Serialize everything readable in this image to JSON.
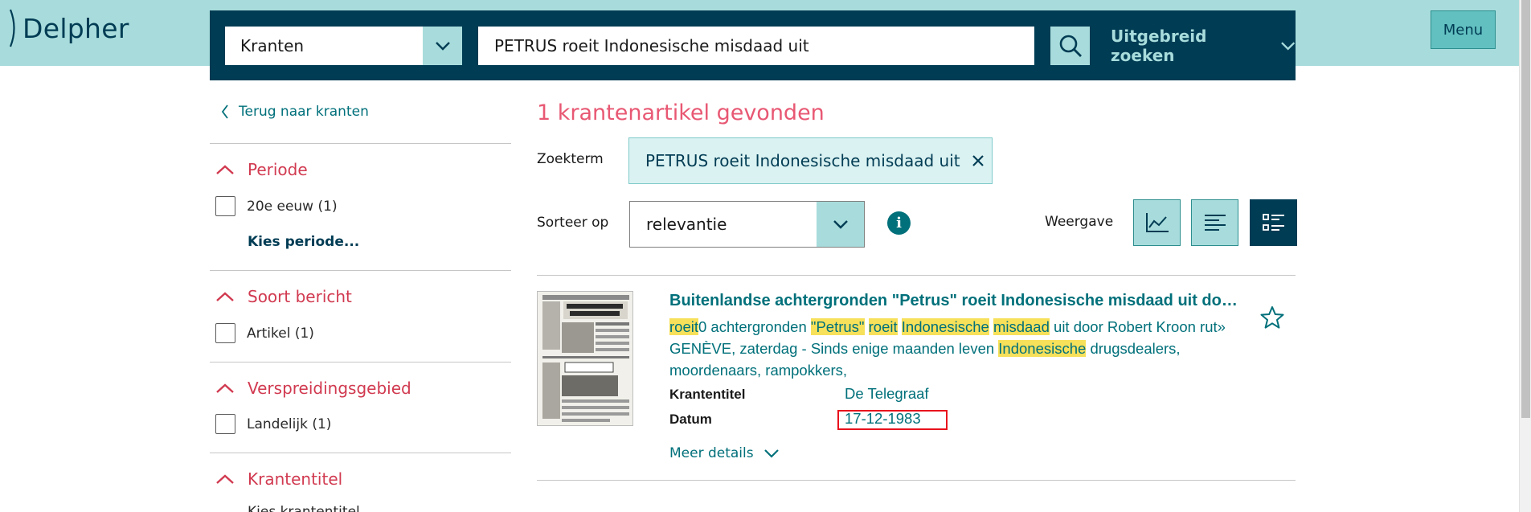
{
  "header": {
    "logo_text": "Delpher",
    "menu_label": "Menu",
    "collection_value": "Kranten",
    "query_value": "PETRUS roeit Indonesische misdaad uit",
    "advanced_label": "Uitgebreid zoeken"
  },
  "sidebar": {
    "back_label": "Terug naar kranten",
    "facets": [
      {
        "title": "Periode",
        "options": [
          "20e eeuw (1)"
        ],
        "more": "Kies periode..."
      },
      {
        "title": "Soort bericht",
        "options": [
          "Artikel (1)"
        ]
      },
      {
        "title": "Verspreidingsgebied",
        "options": [
          "Landelijk (1)"
        ]
      },
      {
        "title": "Krantentitel",
        "more": "Kies krantentitel"
      }
    ]
  },
  "results": {
    "count_text": "1 krantenartikel gevonden",
    "zoekterm_label": "Zoekterm",
    "zoekterm_chip": "PETRUS roeit Indonesische misdaad uit",
    "sort_label": "Sorteer op",
    "sort_value": "relevantie",
    "weergave_label": "Weergave",
    "item": {
      "title": "Buitenlandse achtergronden \"Petrus\" roeit Indonesische misdaad uit door Robert Kroon",
      "snippet": [
        {
          "t": "roeit",
          "hl": true
        },
        {
          "t": "0 achtergronden ",
          "hl": false
        },
        {
          "t": "\"Petrus\"",
          "hl": true
        },
        {
          "t": " ",
          "hl": false
        },
        {
          "t": "roeit",
          "hl": true
        },
        {
          "t": " ",
          "hl": false
        },
        {
          "t": "Indonesische",
          "hl": true
        },
        {
          "t": " ",
          "hl": false
        },
        {
          "t": "misdaad",
          "hl": true
        },
        {
          "t": " uit door Robert Kroon rut» GENÈVE, zaterdag - Sinds enige maanden leven ",
          "hl": false
        },
        {
          "t": "Indonesische",
          "hl": true
        },
        {
          "t": " drugsdealers, moordenaars, rampokkers,",
          "hl": false
        }
      ],
      "krantentitel_label": "Krantentitel",
      "krantentitel_value": "De Telegraaf",
      "datum_label": "Datum",
      "datum_value": "17-12-1983",
      "meer_details": "Meer details"
    }
  },
  "colors": {
    "header_bg": "#a8dcdc",
    "searchbar_bg": "#003c54",
    "accent_red": "#d13a50",
    "count_pink": "#e85873",
    "teal_link": "#00707a",
    "highlight": "#f7e05a"
  },
  "icons": [
    "chevron-down-icon",
    "search-icon",
    "chevron-left-icon",
    "chevron-up-icon",
    "close-icon",
    "info-icon",
    "line-chart-icon",
    "text-list-icon",
    "detail-list-icon",
    "star-icon"
  ]
}
